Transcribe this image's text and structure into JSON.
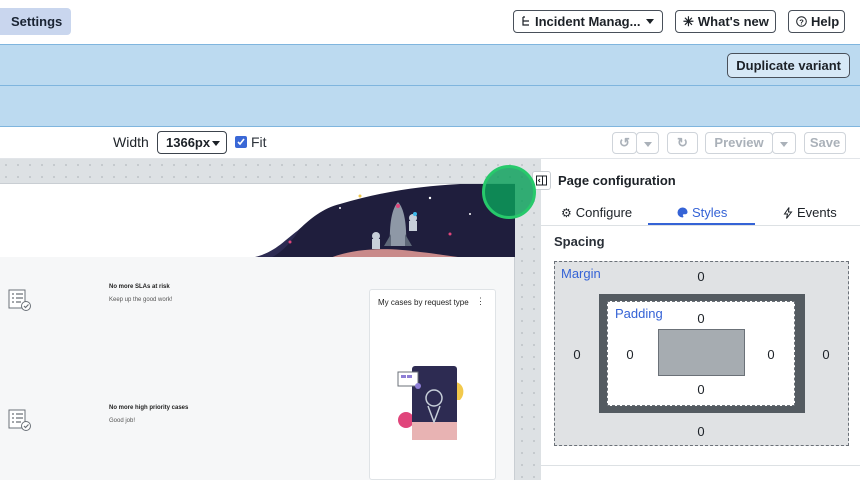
{
  "topbar": {
    "settings_tab": "Settings",
    "app_select": "Incident Manag...",
    "whats_new": "What's new",
    "help": "Help"
  },
  "banner": {
    "duplicate_variant": "Duplicate variant"
  },
  "toolbar": {
    "width_label": "Width",
    "width_value": "1366px",
    "fit_label": "Fit",
    "fit_checked": true,
    "preview": "Preview",
    "save": "Save"
  },
  "canvas": {
    "empty_states": [
      {
        "title": "No more SLAs at risk",
        "subtitle": "Keep up the good work!"
      },
      {
        "title": "No more high priority cases",
        "subtitle": "Good job!"
      }
    ],
    "card": {
      "title": "My cases by request type",
      "menu": "⋮"
    }
  },
  "panel": {
    "title": "Page configuration",
    "tabs": [
      {
        "label": "Configure",
        "icon": "gear-icon",
        "active": false
      },
      {
        "label": "Styles",
        "icon": "palette-icon",
        "active": true
      },
      {
        "label": "Events",
        "icon": "bolt-icon",
        "active": false
      }
    ],
    "section_title": "Spacing",
    "margin": {
      "label": "Margin",
      "top": "0",
      "right": "0",
      "bottom": "0",
      "left": "0"
    },
    "padding": {
      "label": "Padding",
      "top": "0",
      "right": "0",
      "bottom": "0",
      "left": "0"
    }
  },
  "colors": {
    "accent": "#3563d6",
    "banner": "#bcdaf0",
    "settings_tab": "#c9d6ee",
    "cursor_highlight": "#27c96b"
  }
}
